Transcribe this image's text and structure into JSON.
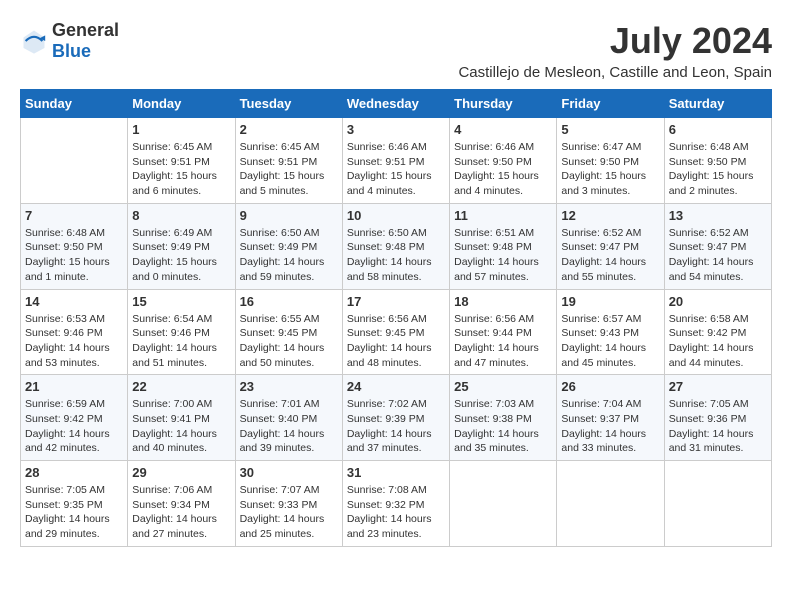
{
  "header": {
    "logo_general": "General",
    "logo_blue": "Blue",
    "title": "July 2024",
    "subtitle": "Castillejo de Mesleon, Castille and Leon, Spain"
  },
  "days_of_week": [
    "Sunday",
    "Monday",
    "Tuesday",
    "Wednesday",
    "Thursday",
    "Friday",
    "Saturday"
  ],
  "weeks": [
    [
      {
        "day": "",
        "info": ""
      },
      {
        "day": "1",
        "info": "Sunrise: 6:45 AM\nSunset: 9:51 PM\nDaylight: 15 hours\nand 6 minutes."
      },
      {
        "day": "2",
        "info": "Sunrise: 6:45 AM\nSunset: 9:51 PM\nDaylight: 15 hours\nand 5 minutes."
      },
      {
        "day": "3",
        "info": "Sunrise: 6:46 AM\nSunset: 9:51 PM\nDaylight: 15 hours\nand 4 minutes."
      },
      {
        "day": "4",
        "info": "Sunrise: 6:46 AM\nSunset: 9:50 PM\nDaylight: 15 hours\nand 4 minutes."
      },
      {
        "day": "5",
        "info": "Sunrise: 6:47 AM\nSunset: 9:50 PM\nDaylight: 15 hours\nand 3 minutes."
      },
      {
        "day": "6",
        "info": "Sunrise: 6:48 AM\nSunset: 9:50 PM\nDaylight: 15 hours\nand 2 minutes."
      }
    ],
    [
      {
        "day": "7",
        "info": "Sunrise: 6:48 AM\nSunset: 9:50 PM\nDaylight: 15 hours\nand 1 minute."
      },
      {
        "day": "8",
        "info": "Sunrise: 6:49 AM\nSunset: 9:49 PM\nDaylight: 15 hours\nand 0 minutes."
      },
      {
        "day": "9",
        "info": "Sunrise: 6:50 AM\nSunset: 9:49 PM\nDaylight: 14 hours\nand 59 minutes."
      },
      {
        "day": "10",
        "info": "Sunrise: 6:50 AM\nSunset: 9:48 PM\nDaylight: 14 hours\nand 58 minutes."
      },
      {
        "day": "11",
        "info": "Sunrise: 6:51 AM\nSunset: 9:48 PM\nDaylight: 14 hours\nand 57 minutes."
      },
      {
        "day": "12",
        "info": "Sunrise: 6:52 AM\nSunset: 9:47 PM\nDaylight: 14 hours\nand 55 minutes."
      },
      {
        "day": "13",
        "info": "Sunrise: 6:52 AM\nSunset: 9:47 PM\nDaylight: 14 hours\nand 54 minutes."
      }
    ],
    [
      {
        "day": "14",
        "info": "Sunrise: 6:53 AM\nSunset: 9:46 PM\nDaylight: 14 hours\nand 53 minutes."
      },
      {
        "day": "15",
        "info": "Sunrise: 6:54 AM\nSunset: 9:46 PM\nDaylight: 14 hours\nand 51 minutes."
      },
      {
        "day": "16",
        "info": "Sunrise: 6:55 AM\nSunset: 9:45 PM\nDaylight: 14 hours\nand 50 minutes."
      },
      {
        "day": "17",
        "info": "Sunrise: 6:56 AM\nSunset: 9:45 PM\nDaylight: 14 hours\nand 48 minutes."
      },
      {
        "day": "18",
        "info": "Sunrise: 6:56 AM\nSunset: 9:44 PM\nDaylight: 14 hours\nand 47 minutes."
      },
      {
        "day": "19",
        "info": "Sunrise: 6:57 AM\nSunset: 9:43 PM\nDaylight: 14 hours\nand 45 minutes."
      },
      {
        "day": "20",
        "info": "Sunrise: 6:58 AM\nSunset: 9:42 PM\nDaylight: 14 hours\nand 44 minutes."
      }
    ],
    [
      {
        "day": "21",
        "info": "Sunrise: 6:59 AM\nSunset: 9:42 PM\nDaylight: 14 hours\nand 42 minutes."
      },
      {
        "day": "22",
        "info": "Sunrise: 7:00 AM\nSunset: 9:41 PM\nDaylight: 14 hours\nand 40 minutes."
      },
      {
        "day": "23",
        "info": "Sunrise: 7:01 AM\nSunset: 9:40 PM\nDaylight: 14 hours\nand 39 minutes."
      },
      {
        "day": "24",
        "info": "Sunrise: 7:02 AM\nSunset: 9:39 PM\nDaylight: 14 hours\nand 37 minutes."
      },
      {
        "day": "25",
        "info": "Sunrise: 7:03 AM\nSunset: 9:38 PM\nDaylight: 14 hours\nand 35 minutes."
      },
      {
        "day": "26",
        "info": "Sunrise: 7:04 AM\nSunset: 9:37 PM\nDaylight: 14 hours\nand 33 minutes."
      },
      {
        "day": "27",
        "info": "Sunrise: 7:05 AM\nSunset: 9:36 PM\nDaylight: 14 hours\nand 31 minutes."
      }
    ],
    [
      {
        "day": "28",
        "info": "Sunrise: 7:05 AM\nSunset: 9:35 PM\nDaylight: 14 hours\nand 29 minutes."
      },
      {
        "day": "29",
        "info": "Sunrise: 7:06 AM\nSunset: 9:34 PM\nDaylight: 14 hours\nand 27 minutes."
      },
      {
        "day": "30",
        "info": "Sunrise: 7:07 AM\nSunset: 9:33 PM\nDaylight: 14 hours\nand 25 minutes."
      },
      {
        "day": "31",
        "info": "Sunrise: 7:08 AM\nSunset: 9:32 PM\nDaylight: 14 hours\nand 23 minutes."
      },
      {
        "day": "",
        "info": ""
      },
      {
        "day": "",
        "info": ""
      },
      {
        "day": "",
        "info": ""
      }
    ]
  ]
}
